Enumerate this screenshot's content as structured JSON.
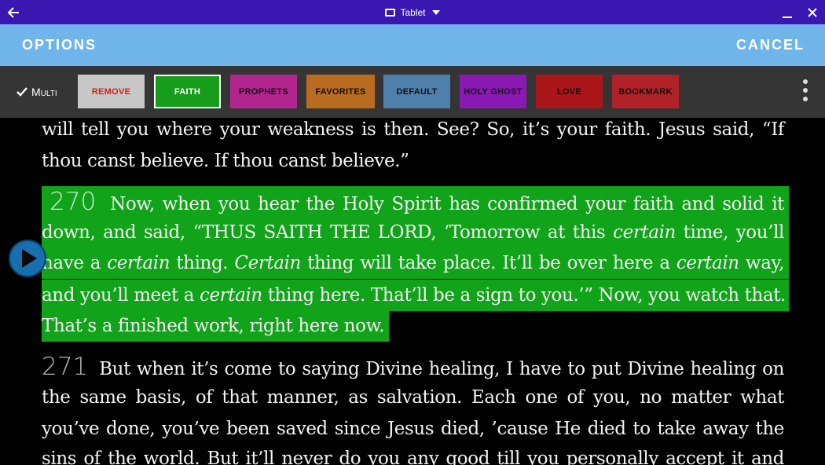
{
  "window": {
    "title": "Tablet",
    "icons": [
      "back-arrow-icon",
      "tablet-icon",
      "caret-down-icon",
      "minimize-icon",
      "close-icon"
    ]
  },
  "header": {
    "title": "OPTIONS",
    "cancel_label": "CANCEL",
    "color": "#6fb5ea"
  },
  "toolbar": {
    "multi_label": "Multi",
    "chips": [
      {
        "label": "REMOVE",
        "bg": "#c7c7c7",
        "fg": "#d0201a",
        "selected": false
      },
      {
        "label": "FAITH",
        "bg": "#169b1b",
        "fg": "#ffffff",
        "selected": true
      },
      {
        "label": "PROPHETS",
        "bg": "#b3258e",
        "fg": "#111111",
        "selected": false
      },
      {
        "label": "FAVORITES",
        "bg": "#b96b1f",
        "fg": "#111111",
        "selected": false
      },
      {
        "label": "DEFAULT",
        "bg": "#4f80ab",
        "fg": "#111111",
        "selected": false
      },
      {
        "label": "HOLY GHOST",
        "bg": "#8a18b2",
        "fg": "#111111",
        "selected": false
      },
      {
        "label": "LOVE",
        "bg": "#aa161a",
        "fg": "#111111",
        "selected": false
      },
      {
        "label": "BOOKMARK",
        "bg": "#b02227",
        "fg": "#111111",
        "selected": false
      }
    ]
  },
  "reader": {
    "lines": [
      {
        "num": "",
        "text": "will tell you where your weakness is then. See? So, it’s your faith. Jesus said, “If",
        "highlight": false
      },
      {
        "num": "",
        "text": "thou canst believe. If thou canst believe.”",
        "highlight": false,
        "last": true
      },
      {
        "num": "270",
        "text": "Now, when you hear the Holy Spirit has confirmed your faith and solid it",
        "highlight": true
      },
      {
        "num": "",
        "html": "down, and said, “THUS SAITH THE LORD, ‘Tomorrow at this <i>certain</i> time, you’ll",
        "highlight": true
      },
      {
        "num": "",
        "html": "have a <i>certain</i> thing. <i>Certain</i> thing will take place. It’ll be over here a <i>certain</i> way,",
        "highlight": true
      },
      {
        "num": "",
        "html": "and you’ll meet a <i>certain</i> thing here. That’ll be a sign to you.’” Now, you watch that.",
        "highlight": true
      },
      {
        "num": "",
        "text": "That’s a finished work, right here now.",
        "highlight": true,
        "last": true
      },
      {
        "num": "271",
        "text": "But when it’s come to saying Divine healing, I have to put Divine healing on",
        "highlight": false
      },
      {
        "num": "",
        "text": "the same basis, of that manner, as salvation. Each one of you, no matter what",
        "highlight": false
      },
      {
        "num": "",
        "text": "you’ve done, you’ve been saved since Jesus died, ’cause He died to take away the",
        "highlight": false
      },
      {
        "num": "",
        "text": "sins of the world. But it’ll never do you any good till you personally accept it and",
        "highlight": false
      }
    ],
    "highlight_color": "#11a31a",
    "play_button": "play-icon"
  }
}
